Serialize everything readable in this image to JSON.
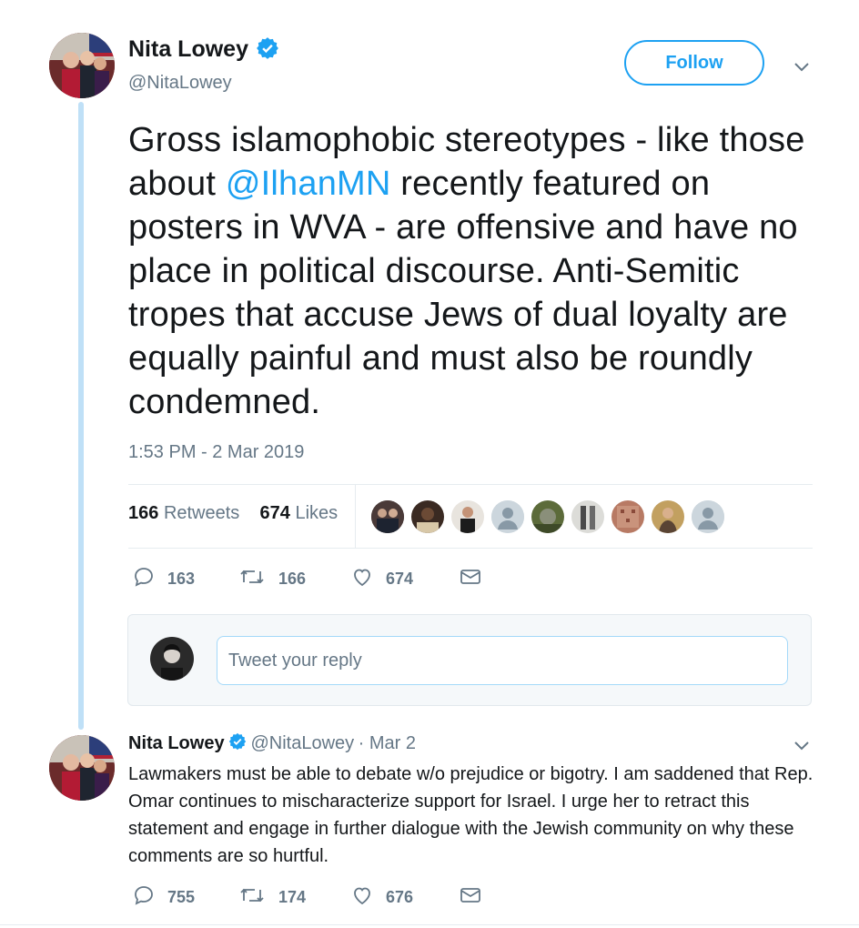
{
  "tweet": {
    "author_name": "Nita Lowey",
    "author_handle": "@NitaLowey",
    "follow_label": "Follow",
    "text_part1": "Gross islamophobic stereotypes - like those about ",
    "mention": "@IlhanMN",
    "text_part2": " recently featured on posters in WVA - are offensive and have no place in political discourse. Anti-Semitic tropes that accuse Jews of dual loyalty are equally painful and must also be roundly condemned.",
    "timestamp": "1:53 PM - 2 Mar 2019",
    "retweets_count": "166",
    "retweets_label": "Retweets",
    "likes_count": "674",
    "likes_label": "Likes",
    "actions": {
      "replies": "163",
      "retweets": "166",
      "likes": "674"
    }
  },
  "reply_composer": {
    "placeholder": "Tweet your reply"
  },
  "reply_tweet": {
    "author_name": "Nita Lowey",
    "author_handle": "@NitaLowey",
    "date": "· Mar 2",
    "text": "Lawmakers must be able to debate w/o prejudice or bigotry. I am saddened that Rep. Omar continues to mischaracterize support for Israel. I urge her to retract this statement and engage in further dialogue with the Jewish community on why these comments are so hurtful.",
    "actions": {
      "replies": "755",
      "retweets": "174",
      "likes": "676"
    }
  },
  "colors": {
    "accent": "#1da1f2",
    "muted": "#657786",
    "text": "#14171a"
  }
}
